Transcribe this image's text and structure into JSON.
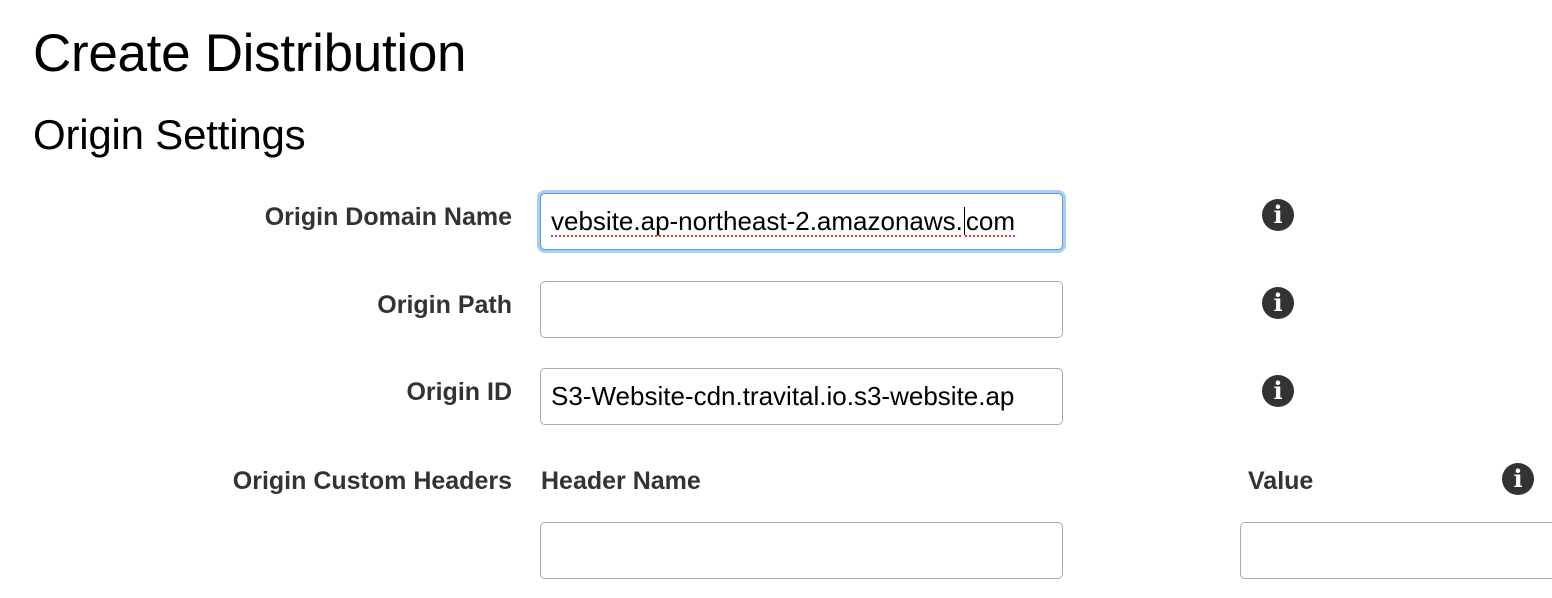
{
  "page": {
    "title": "Create Distribution"
  },
  "origin_settings": {
    "section_title": "Origin Settings",
    "origin_domain_name": {
      "label": "Origin Domain Name",
      "value_start": "vebsite.ap-northeast-2.amazonaws.",
      "value_end": "com",
      "info_icon": "info-icon"
    },
    "origin_path": {
      "label": "Origin Path",
      "value": "",
      "info_icon": "info-icon"
    },
    "origin_id": {
      "label": "Origin ID",
      "value": "S3-Website-cdn.travital.io.s3-website.ap",
      "info_icon": "info-icon"
    },
    "origin_custom_headers": {
      "label": "Origin Custom Headers",
      "header_name_column": "Header Name",
      "value_column": "Value",
      "header_name_value": "",
      "value_value": "",
      "info_icon": "info-icon"
    }
  },
  "colors": {
    "focus_border": "#5b9dd9",
    "focus_glow": "#a9cdf3",
    "label_text": "#333333",
    "info_icon_bg": "#333333",
    "spellcheck_underline": "#e0303a"
  }
}
